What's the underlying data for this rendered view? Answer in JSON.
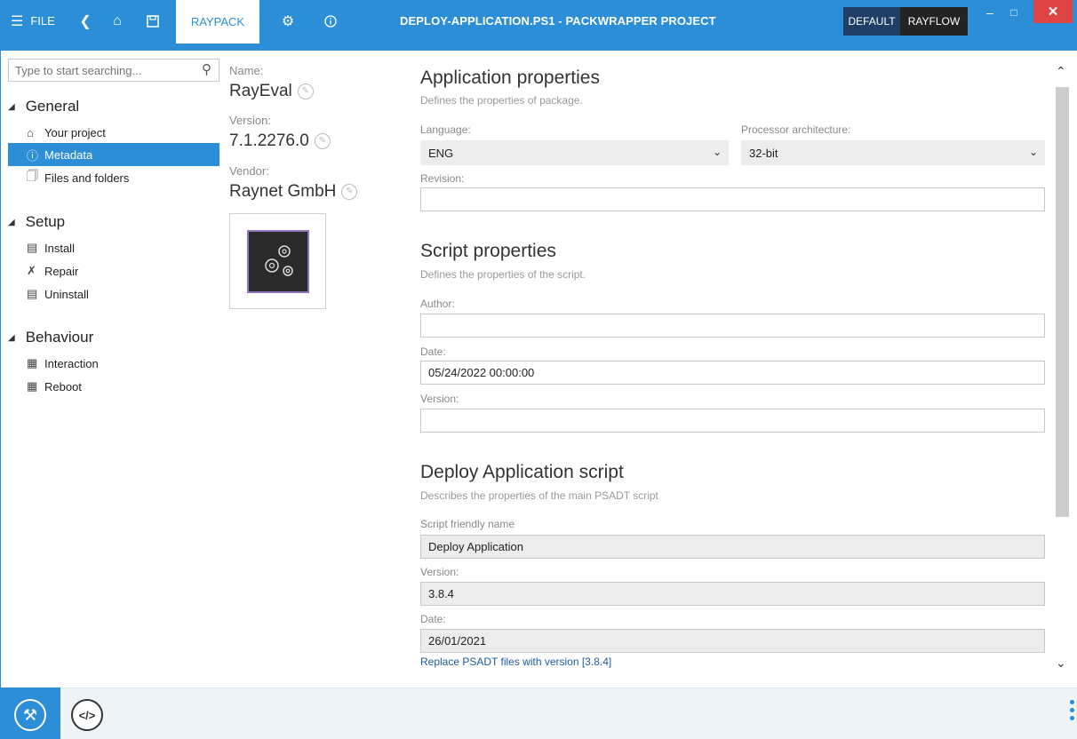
{
  "titlebar": {
    "menu_label": "FILE",
    "active_tab": "RAYPACK",
    "title": "DEPLOY-APPLICATION.PS1 - PACKWRAPPER PROJECT",
    "default_label": "DEFAULT",
    "rayflow_label": "RAYFLOW",
    "accent_color": "#2b8ed6"
  },
  "sidebar": {
    "search_placeholder": "Type to start searching...",
    "sections": [
      {
        "title": "General",
        "items": [
          "Your project",
          "Metadata",
          "Files and folders"
        ]
      },
      {
        "title": "Setup",
        "items": [
          "Install",
          "Repair",
          "Uninstall"
        ]
      },
      {
        "title": "Behaviour",
        "items": [
          "Interaction",
          "Reboot"
        ]
      }
    ],
    "active_item": "Metadata"
  },
  "metadata": {
    "name_label": "Name:",
    "name_value": "RayEval",
    "version_label": "Version:",
    "version_value": "7.1.2276.0",
    "vendor_label": "Vendor:",
    "vendor_value": "Raynet GmbH"
  },
  "app_props": {
    "title": "Application properties",
    "desc": "Defines the properties of package.",
    "language_label": "Language:",
    "language_value": "ENG",
    "processor_label": "Processor architecture:",
    "processor_value": "32-bit",
    "revision_label": "Revision:",
    "revision_value": ""
  },
  "script_props": {
    "title": "Script properties",
    "desc": "Defines the properties of the script.",
    "author_label": "Author:",
    "author_value": "",
    "date_label": "Date:",
    "date_value": "05/24/2022 00:00:00",
    "version_label": "Version:",
    "version_value": ""
  },
  "deploy_script": {
    "title": "Deploy Application script",
    "desc": "Describes the properties of the main PSADT script",
    "friendly_label": "Script friendly name",
    "friendly_value": "Deploy Application",
    "version_label": "Version:",
    "version_value": "3.8.4",
    "date_label": "Date:",
    "date_value": "26/01/2021",
    "replace_link": "Replace PSADT files with version [3.8.4]"
  }
}
